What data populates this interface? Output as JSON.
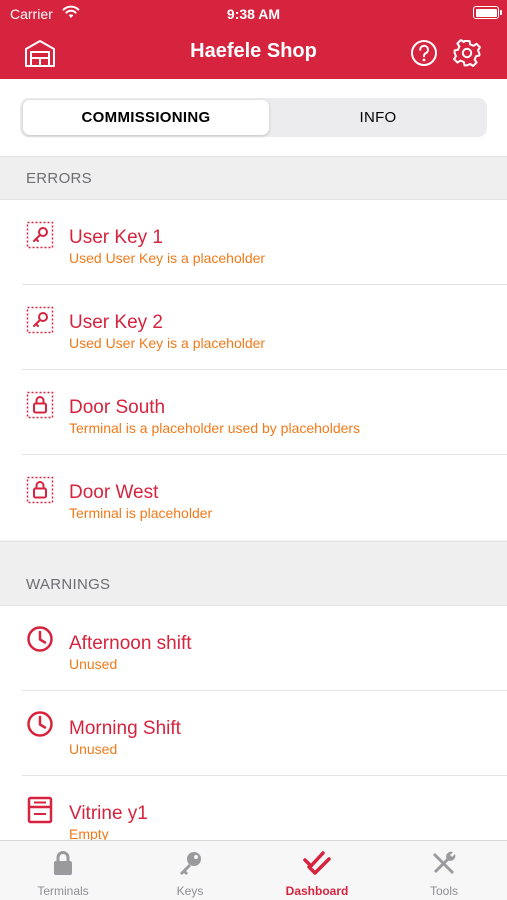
{
  "status_bar": {
    "carrier": "Carrier",
    "time": "9:38 AM"
  },
  "nav": {
    "title": "Haefele Shop",
    "left_icon": "shop-icon",
    "help_icon": "help-icon",
    "settings_icon": "gear-icon"
  },
  "segments": {
    "active": "COMMISSIONING",
    "inactive": "INFO"
  },
  "errors": {
    "header": "ERRORS",
    "items": [
      {
        "title": "User Key 1",
        "subtitle": "Used User Key is a placeholder",
        "icon": "key-icon"
      },
      {
        "title": "User Key 2",
        "subtitle": "Used User Key is a placeholder",
        "icon": "key-icon"
      },
      {
        "title": "Door South",
        "subtitle": "Terminal is a placeholder used by placeholders",
        "icon": "lock-icon"
      },
      {
        "title": "Door West",
        "subtitle": "Terminal is placeholder",
        "icon": "lock-icon"
      }
    ]
  },
  "warnings": {
    "header": "WARNINGS",
    "items": [
      {
        "title": "Afternoon shift",
        "subtitle": "Unused",
        "icon": "clock-icon"
      },
      {
        "title": "Morning Shift",
        "subtitle": "Unused",
        "icon": "clock-icon"
      },
      {
        "title": "Vitrine y1",
        "subtitle": "Empty",
        "icon": "cabinet-icon"
      }
    ]
  },
  "tabs": [
    {
      "label": "Terminals",
      "icon": "lock-icon"
    },
    {
      "label": "Keys",
      "icon": "key-icon"
    },
    {
      "label": "Dashboard",
      "icon": "checkmarks-icon",
      "active": true
    },
    {
      "label": "Tools",
      "icon": "tools-icon"
    }
  ],
  "colors": {
    "brand": "#d6243f",
    "warning_text": "#f07a1a",
    "inactive_tab": "#8e8e93"
  }
}
